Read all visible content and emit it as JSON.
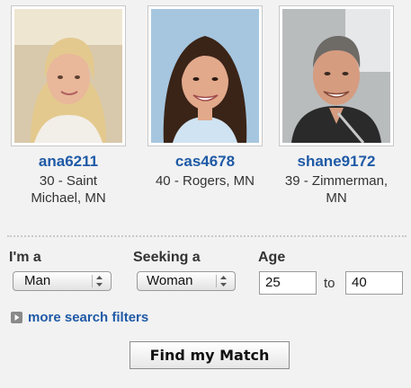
{
  "profiles": [
    {
      "username": "ana6211",
      "details": "30 - Saint Michael, MN",
      "colors": {
        "bg": "#d8c9ac",
        "hair": "#e4c98e",
        "skin": "#e9b79a",
        "shirt": "#f2eee8"
      }
    },
    {
      "username": "cas4678",
      "details": "40 - Rogers, MN",
      "colors": {
        "bg": "#a6c6df",
        "hair": "#3a2417",
        "skin": "#e2a98b",
        "shirt": "#cfe3f2"
      }
    },
    {
      "username": "shane9172",
      "details": "39 - Zimmerman, MN",
      "colors": {
        "bg": "#b8bcbd",
        "hair": "#6e6a66",
        "skin": "#d59c80",
        "shirt": "#2a2a2a"
      }
    }
  ],
  "search": {
    "im_a_label": "I'm a",
    "seeking_label": "Seeking a",
    "age_label": "Age",
    "gender_value": "Man",
    "seeking_value": "Woman",
    "age_min": "25",
    "age_to_label": "to",
    "age_max": "40",
    "more_filters_label": "more search filters",
    "submit_label": "Find my Match"
  },
  "colors": {
    "background": "#f2f2f2",
    "link": "#1f5aa6"
  },
  "icons": {
    "select_arrows": "updown-arrows-icon",
    "more_filters": "plus-icon"
  }
}
